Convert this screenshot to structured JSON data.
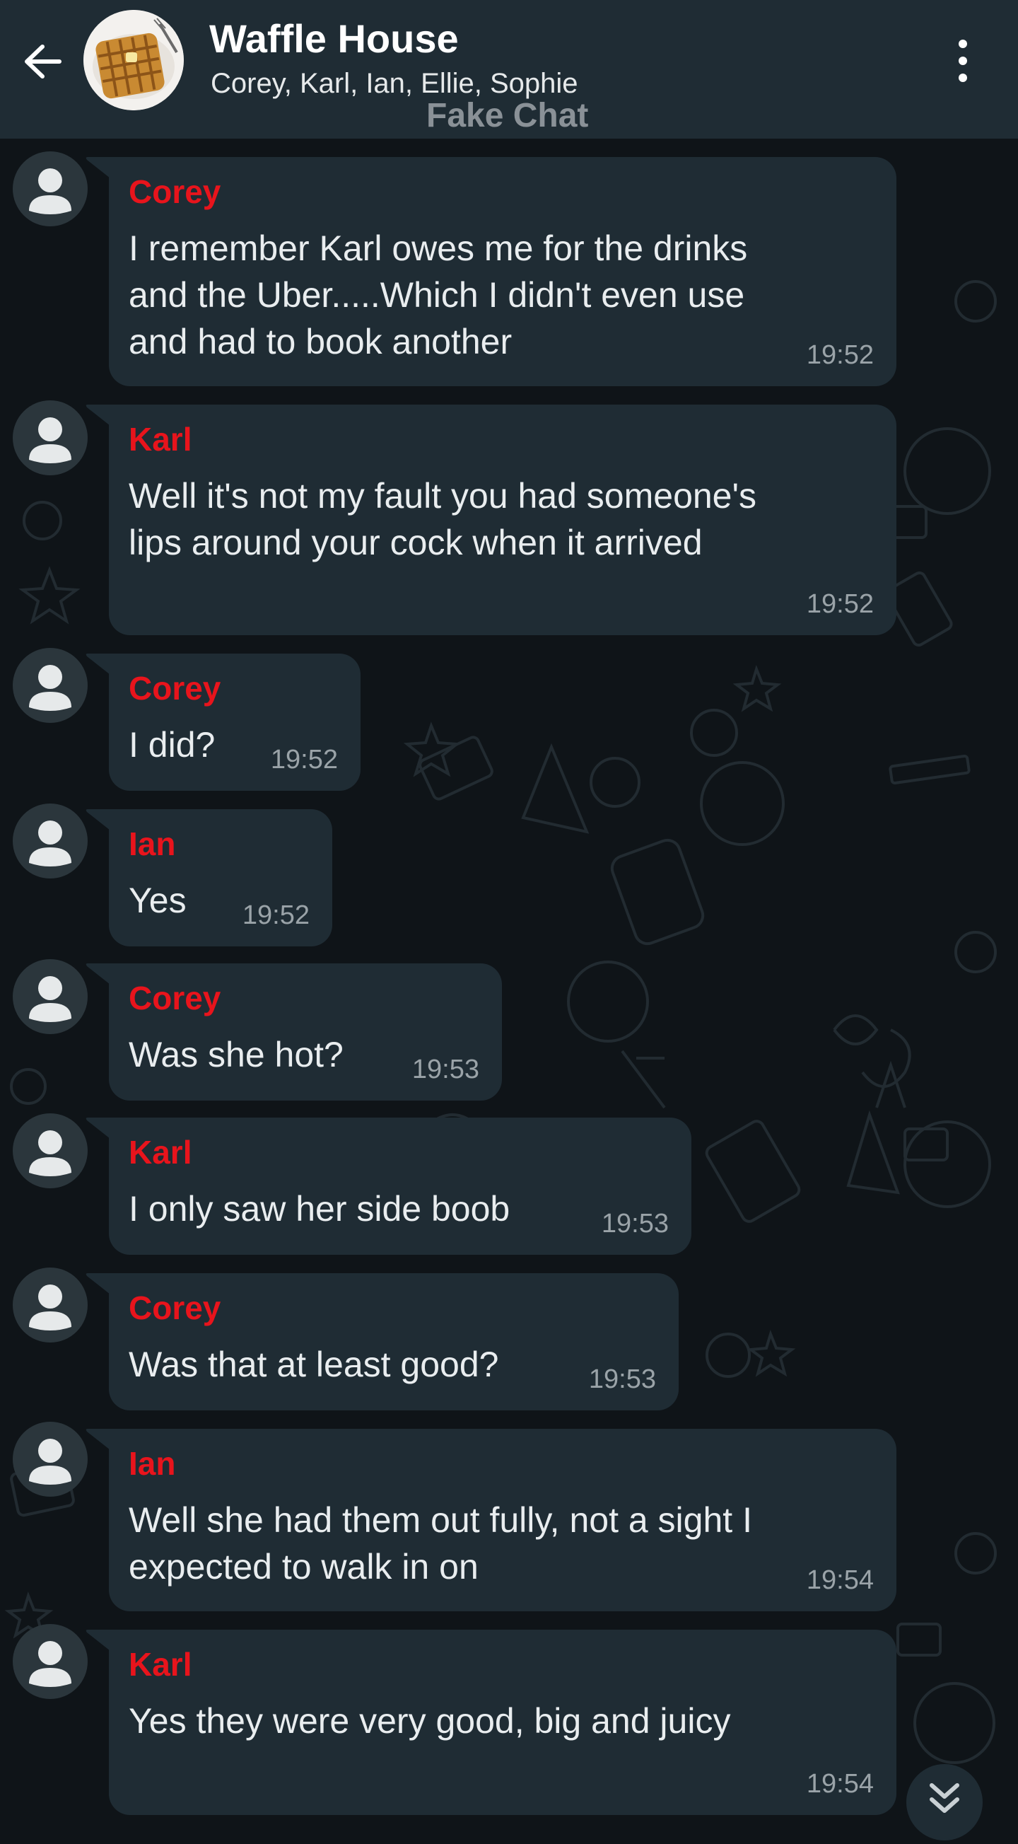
{
  "header": {
    "title": "Waffle House",
    "members": "Corey, Karl, Ian, Ellie, Sophie",
    "watermark": "Fake Chat",
    "back_icon": "arrow-left-icon",
    "menu_icon": "more-vertical-icon",
    "avatar": "waffle-image"
  },
  "colors": {
    "header_bg": "#1f2c34",
    "chat_bg": "#0f1418",
    "bubble_bg": "#1f2c34",
    "sender_name": "#e8141c",
    "message_text": "#e9edef",
    "timestamp": "#9aa3a8"
  },
  "messages": [
    {
      "sender": "Corey",
      "text": "I remember Karl owes me for the drinks\nand the Uber.....Which I didn't even use\nand had to book another",
      "time": "19:52"
    },
    {
      "sender": "Karl",
      "text": "Well it's not my fault you had someone's\nlips around your cock when it arrived",
      "time": "19:52"
    },
    {
      "sender": "Corey",
      "text": "I did?",
      "time": "19:52"
    },
    {
      "sender": "Ian",
      "text": "Yes",
      "time": "19:52"
    },
    {
      "sender": "Corey",
      "text": "Was she hot?",
      "time": "19:53"
    },
    {
      "sender": "Karl",
      "text": "I only saw her side boob",
      "time": "19:53"
    },
    {
      "sender": "Corey",
      "text": "Was that at least good?",
      "time": "19:53"
    },
    {
      "sender": "Ian",
      "text": "Well she had them out fully, not a sight I\nexpected to walk in on",
      "time": "19:54"
    },
    {
      "sender": "Karl",
      "text": "Yes they were very good, big and juicy",
      "time": "19:54"
    }
  ],
  "scroll_button_icon": "double-chevron-down-icon"
}
